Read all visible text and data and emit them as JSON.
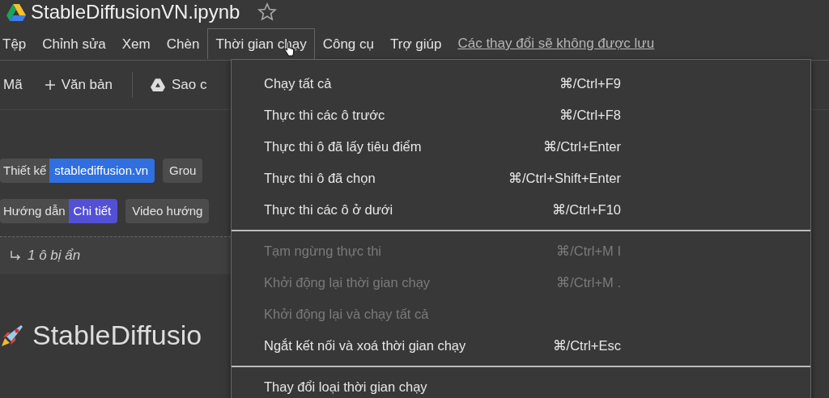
{
  "title": "StableDiffusionVN.ipynb",
  "menubar": [
    {
      "label": "Tệp",
      "selected": false
    },
    {
      "label": "Chỉnh sửa",
      "selected": false
    },
    {
      "label": "Xem",
      "selected": false
    },
    {
      "label": "Chèn",
      "selected": false
    },
    {
      "label": "Thời gian chạy",
      "selected": true
    },
    {
      "label": "Công cụ",
      "selected": false
    },
    {
      "label": "Trợ giúp",
      "selected": false
    }
  ],
  "unsaved_link": "Các thay đổi sẽ không được lưu",
  "toolbar": {
    "code": "Mã",
    "text": "Văn bản",
    "copy": "Sao c"
  },
  "badges": [
    {
      "label": "Thiết kế",
      "value": "stablediffusion.vn",
      "color": "#2f6fe0",
      "next": "Grou"
    },
    {
      "label": "Hướng dẫn",
      "value": "Chi tiết",
      "color": "#5350d6",
      "next": "Video hướng"
    }
  ],
  "hidden_cells": "1 ô bị ẩn",
  "heading": "StableDiffusio",
  "menu": [
    [
      {
        "label": "Chạy tất cả",
        "shortcut": "⌘/Ctrl+F9",
        "disabled": false
      },
      {
        "label": "Thực thi các ô trước",
        "shortcut": "⌘/Ctrl+F8",
        "disabled": false
      },
      {
        "label": "Thực thi ô đã lấy tiêu điểm",
        "shortcut": "⌘/Ctrl+Enter",
        "disabled": false
      },
      {
        "label": "Thực thi ô đã chọn",
        "shortcut": "⌘/Ctrl+Shift+Enter",
        "disabled": false
      },
      {
        "label": "Thực thi các ô ở dưới",
        "shortcut": "⌘/Ctrl+F10",
        "disabled": false
      }
    ],
    [
      {
        "label": "Tạm ngừng thực thi",
        "shortcut": "⌘/Ctrl+M I",
        "disabled": true
      },
      {
        "label": "Khởi động lại thời gian chạy",
        "shortcut": "⌘/Ctrl+M .",
        "disabled": true
      },
      {
        "label": "Khởi động lại và chạy tất cả",
        "disabled": true
      },
      {
        "label": "Ngắt kết nối và xoá thời gian chạy",
        "shortcut": "⌘/Ctrl+Esc",
        "disabled": false
      }
    ],
    [
      {
        "label": "Thay đổi loại thời gian chạy",
        "disabled": false
      }
    ]
  ]
}
